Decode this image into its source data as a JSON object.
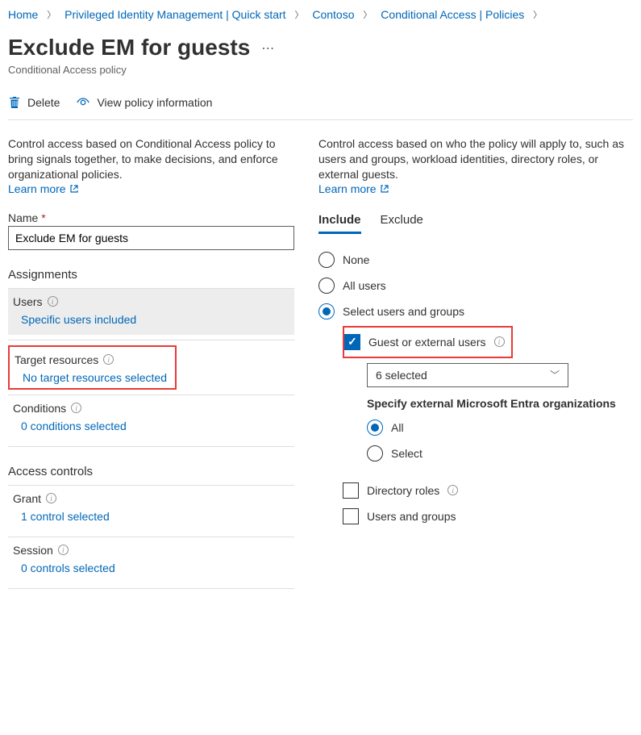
{
  "breadcrumb": {
    "items": [
      "Home",
      "Privileged Identity Management | Quick start",
      "Contoso",
      "Conditional Access | Policies"
    ]
  },
  "page": {
    "title": "Exclude EM for guests",
    "subtitle": "Conditional Access policy"
  },
  "toolbar": {
    "delete": "Delete",
    "view": "View policy information"
  },
  "left": {
    "intro": "Control access based on Conditional Access policy to bring signals together, to make decisions, and enforce organizational policies.",
    "learn_more": "Learn more",
    "name_label": "Name",
    "name_value": "Exclude EM for guests",
    "assignments_header": "Assignments",
    "users_label": "Users",
    "users_link": "Specific users included",
    "target_label": "Target resources",
    "target_link": "No target resources selected",
    "conditions_label": "Conditions",
    "conditions_link": "0 conditions selected",
    "access_header": "Access controls",
    "grant_label": "Grant",
    "grant_link": "1 control selected",
    "session_label": "Session",
    "session_link": "0 controls selected"
  },
  "right": {
    "intro": "Control access based on who the policy will apply to, such as users and groups, workload identities, directory roles, or external guests.",
    "learn_more": "Learn more",
    "tab_include": "Include",
    "tab_exclude": "Exclude",
    "opt_none": "None",
    "opt_all": "All users",
    "opt_select": "Select users and groups",
    "chk_guest": "Guest or external users",
    "dropdown_value": "6 selected",
    "specify_heading": "Specify external Microsoft Entra organizations",
    "org_all": "All",
    "org_select": "Select",
    "chk_roles": "Directory roles",
    "chk_users_groups": "Users and groups"
  }
}
